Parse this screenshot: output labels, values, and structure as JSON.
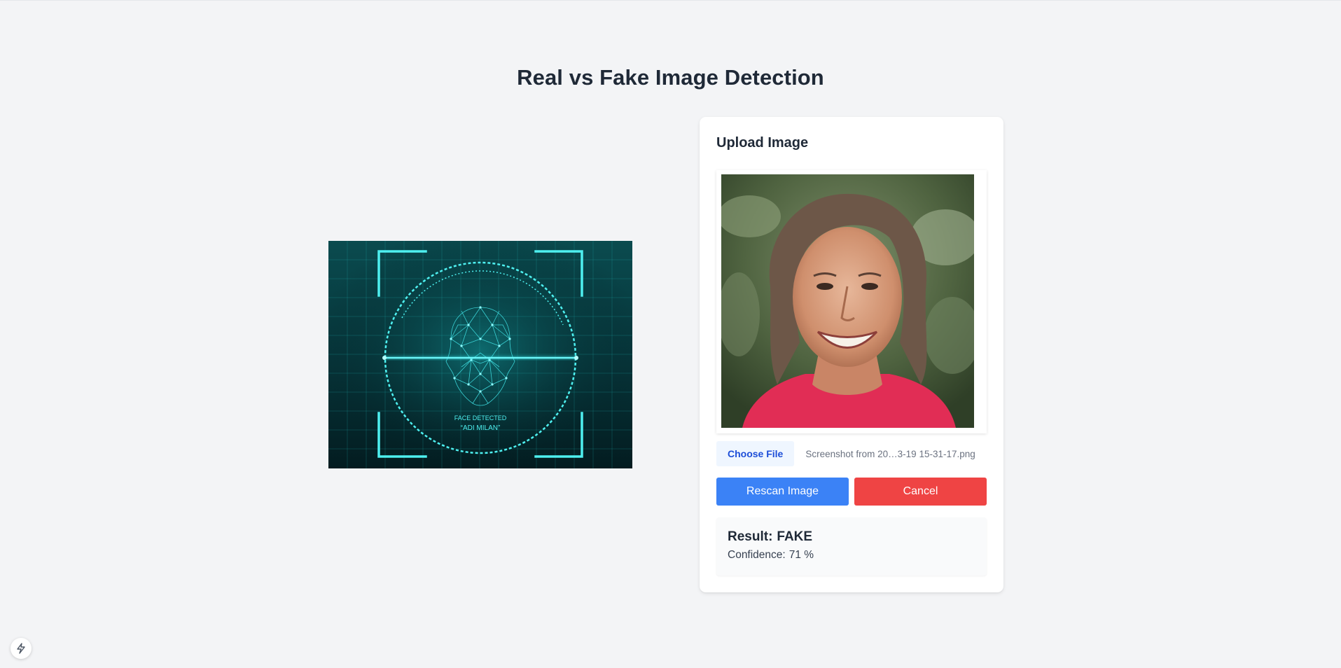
{
  "page": {
    "title": "Real vs Fake Image Detection"
  },
  "hero": {
    "caption_line1": "FACE DETECTED",
    "caption_line2": "“ADI MILAN”",
    "accent_color": "#22d3ee"
  },
  "upload": {
    "title": "Upload Image",
    "choose_file_label": "Choose File",
    "file_name": "Screenshot from 20…3-19 15-31-17.png",
    "rescan_label": "Rescan Image",
    "cancel_label": "Cancel"
  },
  "result": {
    "label": "Result:",
    "verdict": "FAKE",
    "confidence_label": "Confidence:",
    "confidence_value": "71 %"
  },
  "colors": {
    "primary": "#3b82f6",
    "danger": "#ef4444",
    "background": "#f3f4f6"
  },
  "icons": {
    "dev_badge": "lightning-bolt-icon"
  }
}
